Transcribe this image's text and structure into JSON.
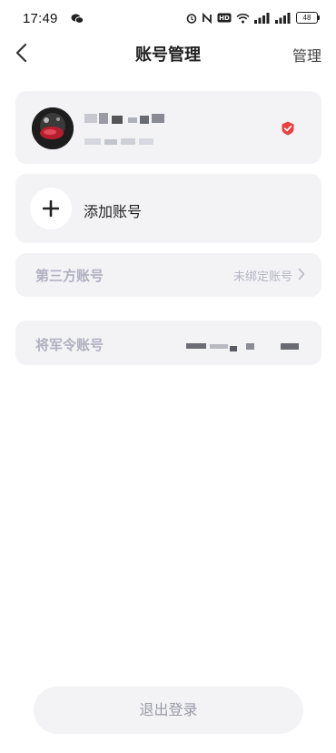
{
  "status_bar": {
    "time": "17:49",
    "battery": "48",
    "icons": [
      "wechat-icon",
      "alarm-icon",
      "nfc-icon",
      "hd-icon",
      "wifi-icon",
      "signal-icon",
      "signal-icon",
      "battery-icon"
    ]
  },
  "header": {
    "title": "账号管理",
    "manage_label": "管理",
    "back_icon": "chevron-left-icon"
  },
  "account": {
    "selected": true,
    "check_color": "#e8413e"
  },
  "add_account": {
    "label": "添加账号"
  },
  "third_party": {
    "label": "第三方账号",
    "value": "未绑定账号"
  },
  "jiangjunling": {
    "label": "将军令账号"
  },
  "footer": {
    "logout_label": "退出登录"
  }
}
